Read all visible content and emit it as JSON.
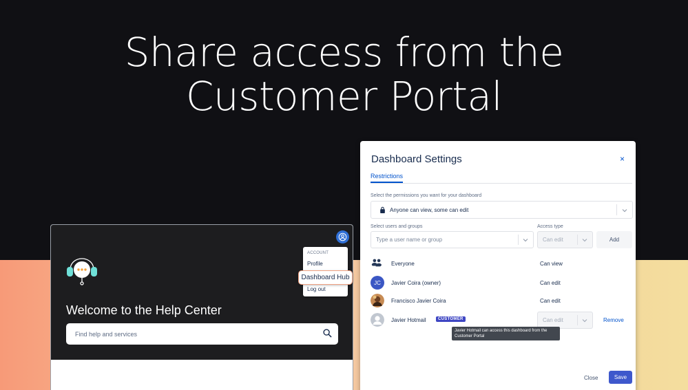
{
  "headline": {
    "line1": "Share access from the",
    "line2": "Customer Portal"
  },
  "help_center": {
    "welcome": "Welcome to the Help Center",
    "search_placeholder": "Find help and services",
    "account_menu": {
      "heading": "ACCOUNT",
      "items": [
        "Profile",
        "Log out"
      ]
    },
    "dashboard_hub_label": "Dashboard Hub"
  },
  "dashboard_settings": {
    "title": "Dashboard Settings",
    "close_symbol": "×",
    "tab_label": "Restrictions",
    "permissions_label": "Select the permissions you want for your dashboard",
    "permissions_value": "Anyone can view, some can edit",
    "users_label": "Select users and groups",
    "users_placeholder": "Type a user name or group",
    "access_type_label": "Access type",
    "access_type_value": "Can edit",
    "add_label": "Add",
    "rows": [
      {
        "name": "Everyone",
        "access": "Can view"
      },
      {
        "name": "Javier Coira (owner)",
        "access": "Can edit",
        "initials": "JC"
      },
      {
        "name": "Francisco Javier Coira",
        "access": "Can edit"
      },
      {
        "name": "Javier Hotmail",
        "badge": "CUSTOMER",
        "access": "Can edit",
        "remove_label": "Remove"
      }
    ],
    "tooltip": "Javier Hotmail can access this dashboard from the Customer Portal",
    "close_label": "Close",
    "save_label": "Save"
  },
  "colors": {
    "accent": "#0052cc",
    "save": "#3e58cc",
    "badge": "#3e46c3",
    "avatar_jc": "#3b57c4"
  }
}
